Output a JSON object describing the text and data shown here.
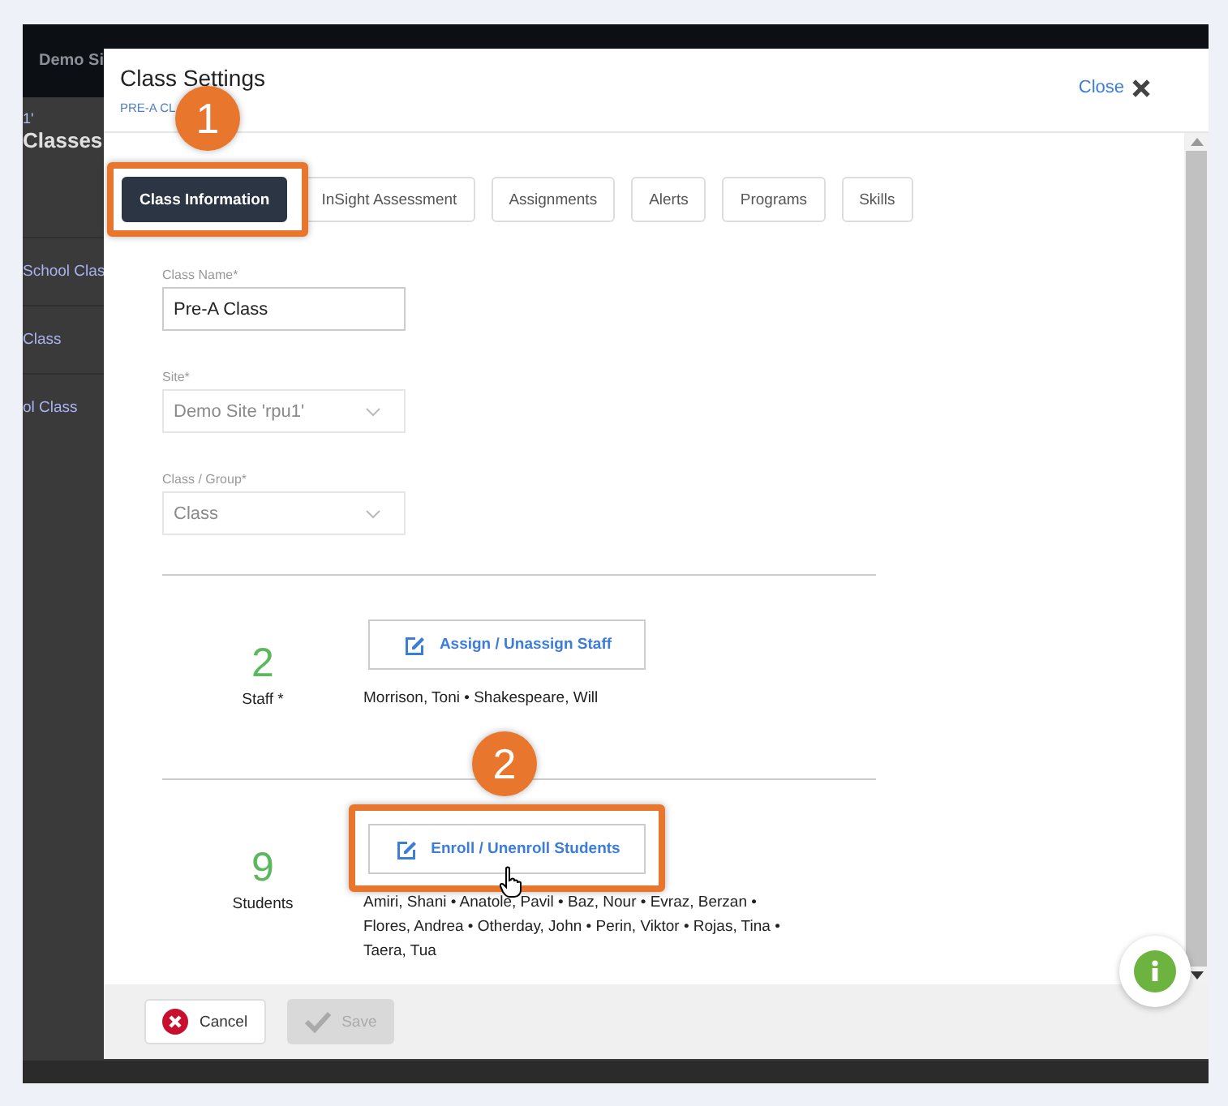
{
  "background": {
    "site_label": "Demo Si",
    "breadcrumb": "1'",
    "heading": "Classes",
    "list_items": [
      "School Clas",
      "Class",
      "ol Class"
    ]
  },
  "modal": {
    "title": "Class Settings",
    "subtitle": "PRE-A CL",
    "close": "Close",
    "tabs": [
      {
        "label": "Class Information",
        "selected": true
      },
      {
        "label": "InSight Assessment",
        "selected": false
      },
      {
        "label": "Assignments",
        "selected": false
      },
      {
        "label": "Alerts",
        "selected": false
      },
      {
        "label": "Programs",
        "selected": false
      },
      {
        "label": "Skills",
        "selected": false
      }
    ],
    "fields": [
      {
        "label": "Class Name*",
        "value": "Pre-A Class",
        "kind": "text",
        "disabled": false
      },
      {
        "label": "Site*",
        "value": "Demo Site 'rpu1'",
        "kind": "select",
        "disabled": true
      },
      {
        "label": "Class / Group*",
        "value": "Class",
        "kind": "select",
        "disabled": true
      }
    ],
    "sections": [
      {
        "count": "2",
        "label": "Staff *",
        "button": "Assign / Unassign Staff",
        "members": "Morrison, Toni • Shakespeare, Will"
      },
      {
        "count": "9",
        "label": "Students",
        "button": "Enroll / Unenroll Students",
        "members": "Amiri, Shani • Anatole, Pavil • Baz, Nour • Evraz, Berzan • Flores, Andrea • Otherday, John • Perin, Viktor • Rojas, Tina • Taera, Tua"
      }
    ],
    "footer": [
      {
        "label": "Cancel",
        "kind": "cancel",
        "disabled": false
      },
      {
        "label": "Save",
        "kind": "save",
        "disabled": true
      }
    ]
  },
  "annotations": [
    {
      "number": "1"
    },
    {
      "number": "2"
    }
  ]
}
